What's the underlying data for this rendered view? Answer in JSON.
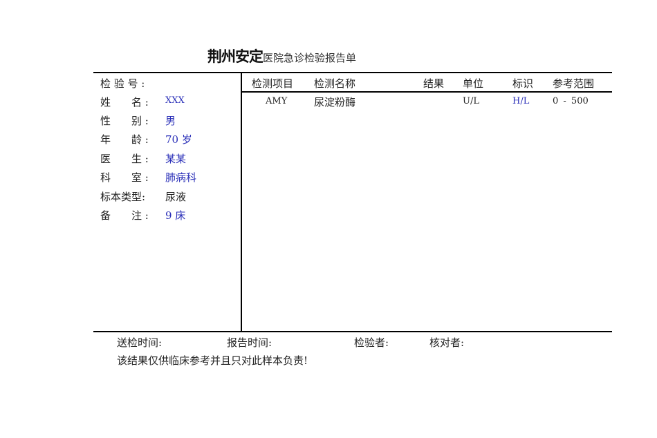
{
  "report": {
    "title_bold": "荆州安定",
    "title_rest": "医院急诊检验报告单"
  },
  "patient": {
    "fields": [
      {
        "label": "检 验 号 :",
        "value": ""
      },
      {
        "label": "姓　　名 :",
        "value": "XXX"
      },
      {
        "label": "性　　别 :",
        "value": "男"
      },
      {
        "label": "年　　龄 :",
        "value": "70 岁"
      },
      {
        "label": "医　　生 :",
        "value": "某某"
      },
      {
        "label": "科　　室 :",
        "value": "肺病科"
      },
      {
        "label": "标本类型:",
        "value": "尿液"
      },
      {
        "label": "备　　注 :",
        "value": "9 床"
      }
    ]
  },
  "table": {
    "headers": [
      "检测项目",
      "检测名称",
      "结果",
      "单位",
      "标识",
      "参考范围"
    ],
    "rows": [
      {
        "code": "AMY",
        "name": "尿淀粉酶",
        "result": "",
        "unit": "U/L",
        "flag": "H/L",
        "range": "0 - 500"
      }
    ]
  },
  "footer": {
    "send_time_label": "送检时间:",
    "report_time_label": "报告时间:",
    "tester_label": "检验者:",
    "checker_label": "核对者:",
    "disclaimer": "该结果仅供临床参考并且只对此样本负责!"
  },
  "colors": {
    "value_blue": "#2a2fb8"
  }
}
